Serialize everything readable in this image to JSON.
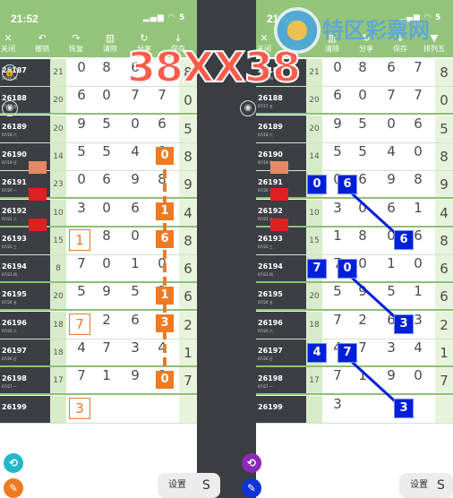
{
  "status": {
    "time": "21:52",
    "icons": "▂▄▆ ◠ 5"
  },
  "toolbar_left": [
    {
      "icon": "✕",
      "label": "关闭"
    },
    {
      "icon": "↶",
      "label": "撤销"
    },
    {
      "icon": "↷",
      "label": "恢复"
    },
    {
      "icon": "▥",
      "label": "清除"
    },
    {
      "icon": "↻",
      "label": "分享"
    },
    {
      "icon": "↓",
      "label": "保存"
    },
    {
      "icon": "▼",
      "label": "排列五"
    }
  ],
  "toolbar_right": [
    {
      "icon": "✕",
      "label": "关闭"
    },
    {
      "icon": "↷",
      "label": "恢复"
    },
    {
      "icon": "▥",
      "label": "清除"
    },
    {
      "icon": "↻",
      "label": "分享"
    },
    {
      "icon": "↓",
      "label": "保存"
    },
    {
      "icon": "▼",
      "label": "排列五"
    }
  ],
  "overlay_title": "38XX38",
  "watermark": "特区彩票网",
  "rows": [
    {
      "issue": "26187",
      "date": "07/16 四",
      "span": "21",
      "digits": [
        "0",
        "8",
        "6",
        "7",
        "8"
      ]
    },
    {
      "issue": "26188",
      "date": "07/17 五",
      "span": "20",
      "digits": [
        "6",
        "0",
        "7",
        "7",
        "0"
      ]
    },
    {
      "issue": "26189",
      "date": "07/18 六",
      "span": "20",
      "digits": [
        "9",
        "5",
        "0",
        "6",
        "5"
      ]
    },
    {
      "issue": "26190",
      "date": "07/19 日",
      "span": "14",
      "digits": [
        "5",
        "5",
        "4",
        "0",
        "8"
      ]
    },
    {
      "issue": "26191",
      "date": "07/20 一",
      "span": "23",
      "digits": [
        "0",
        "6",
        "9",
        "8",
        "9"
      ]
    },
    {
      "issue": "26192",
      "date": "07/21 二",
      "span": "10",
      "digits": [
        "3",
        "0",
        "6",
        "1",
        "4"
      ]
    },
    {
      "issue": "26193",
      "date": "07/22 三",
      "span": "15",
      "digits": [
        "1",
        "8",
        "0",
        "6",
        "8"
      ]
    },
    {
      "issue": "26194",
      "date": "07/23 四",
      "span": "8",
      "digits": [
        "7",
        "0",
        "1",
        "0",
        "6"
      ]
    },
    {
      "issue": "26195",
      "date": "07/24 五",
      "span": "20",
      "digits": [
        "5",
        "9",
        "5",
        "1",
        "6"
      ]
    },
    {
      "issue": "26196",
      "date": "07/25 六",
      "span": "18",
      "digits": [
        "7",
        "2",
        "6",
        "3",
        "2"
      ]
    },
    {
      "issue": "26197",
      "date": "07/26 日",
      "span": "18",
      "digits": [
        "4",
        "7",
        "3",
        "4",
        "1"
      ]
    },
    {
      "issue": "26198",
      "date": "07/27 一",
      "span": "17",
      "digits": [
        "7",
        "1",
        "9",
        "0",
        "7"
      ]
    },
    {
      "issue": "26199",
      "date": "",
      "span": "",
      "digits": [
        "3",
        "",
        "",
        "",
        ""
      ]
    }
  ],
  "settings_label": "设置",
  "settings_icon": "S",
  "colors": {
    "toolbar": "#93c47a",
    "orange": "#f07a22",
    "blue": "#0020d8",
    "red_overlay": "#ff5b4b"
  }
}
